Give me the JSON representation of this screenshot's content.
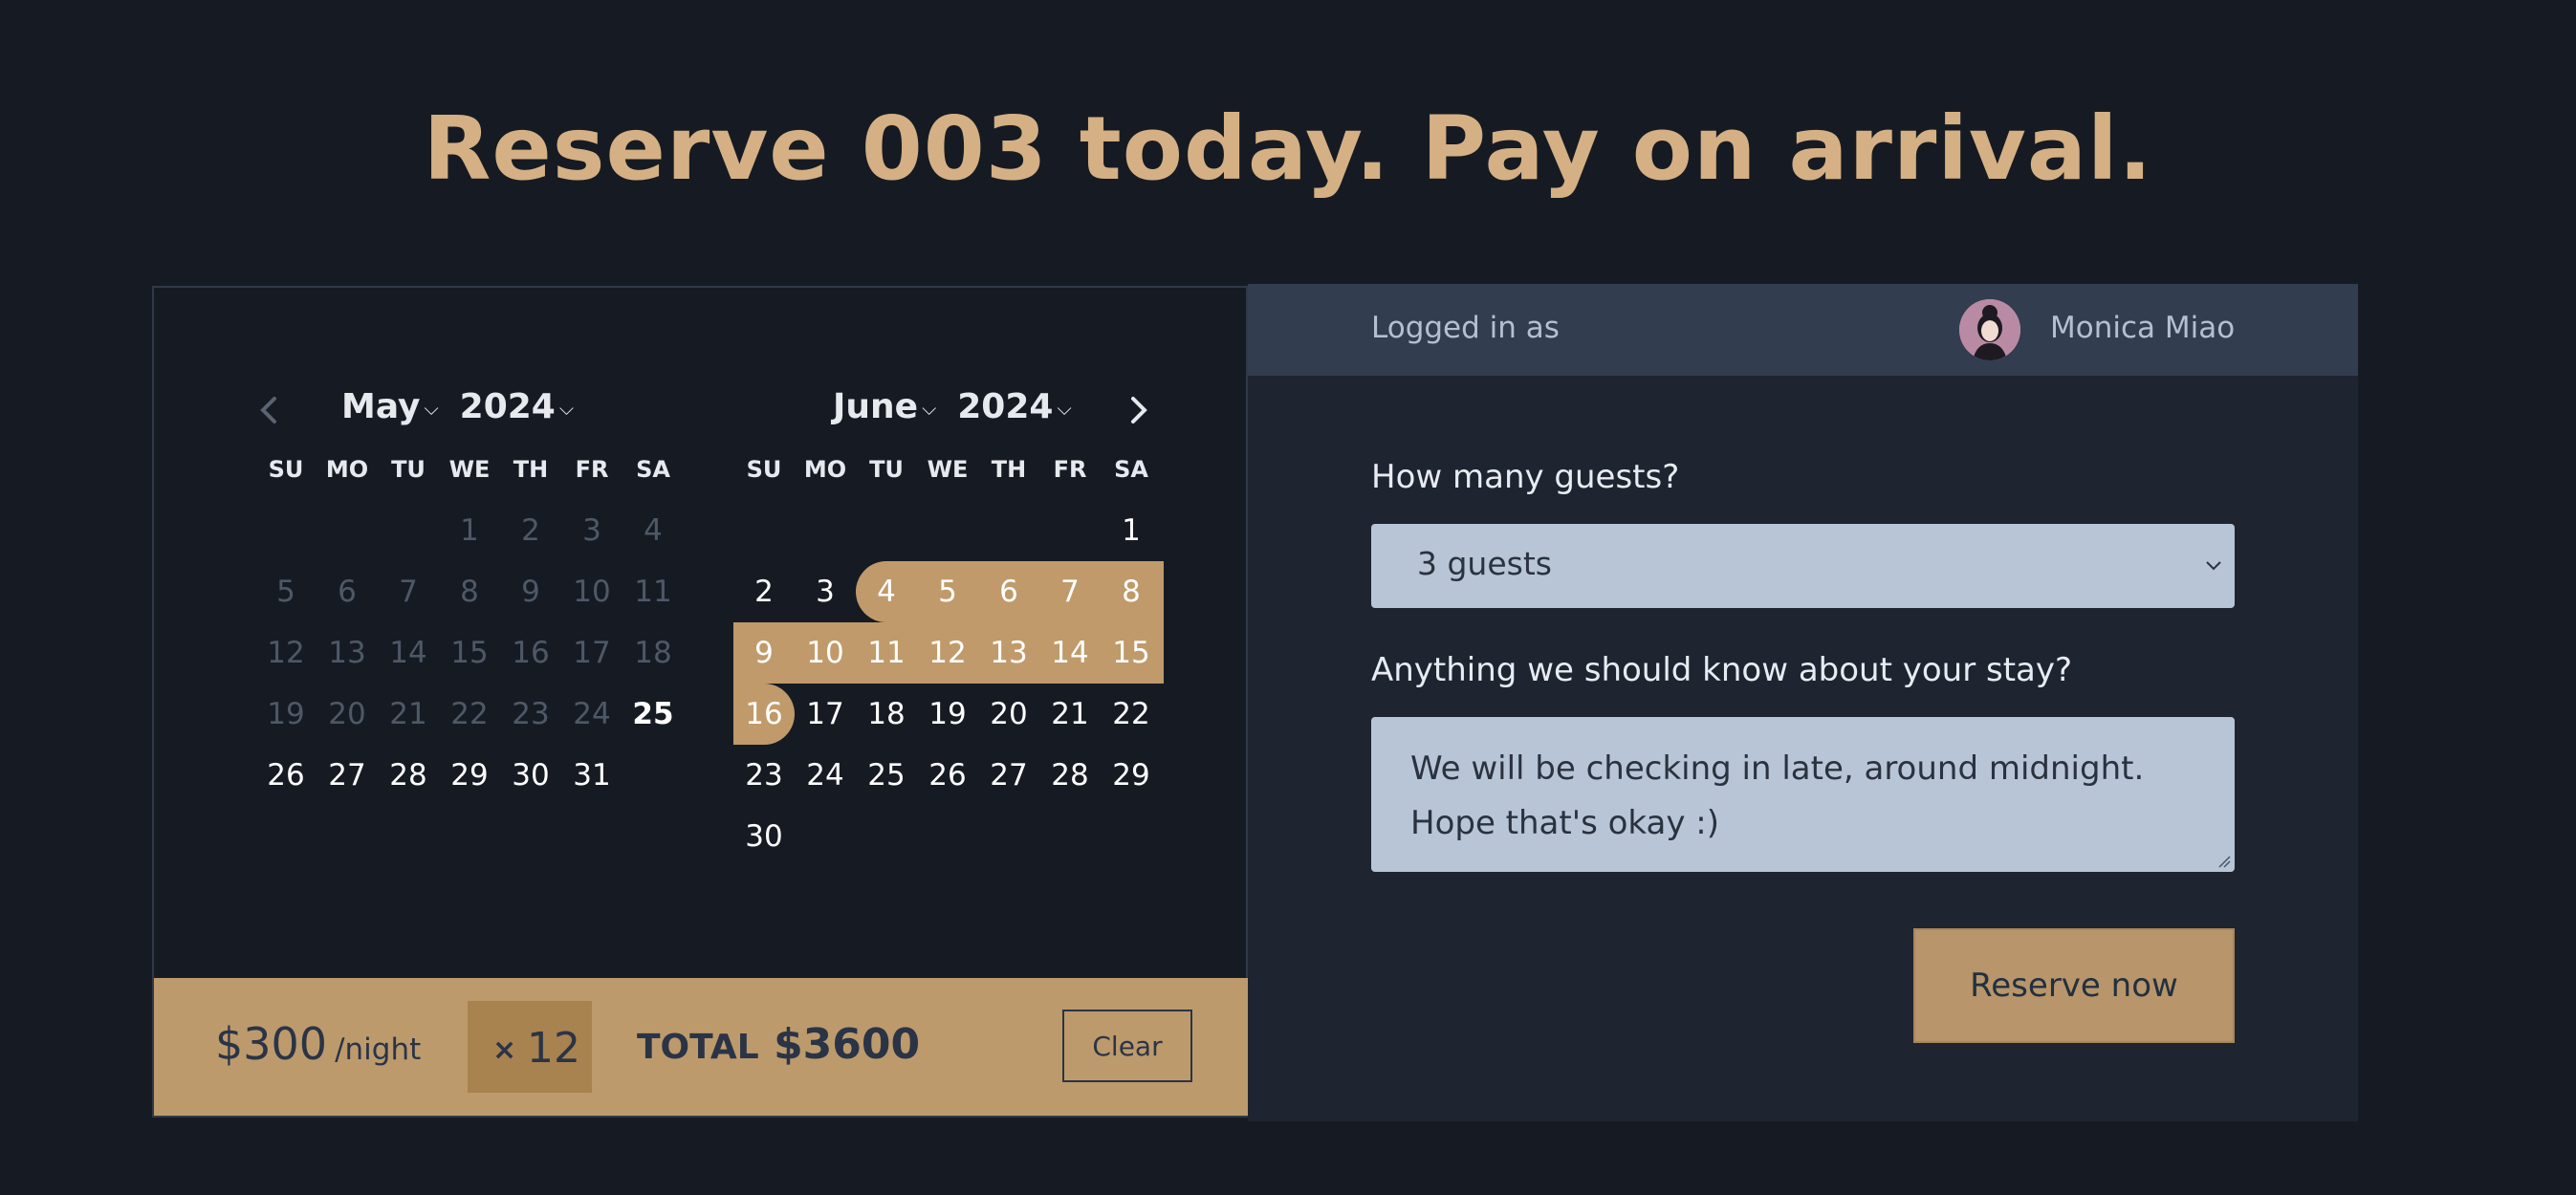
{
  "headline": "Reserve 003 today. Pay on arrival.",
  "login": {
    "label": "Logged in as",
    "user_name": "Monica Miao"
  },
  "form": {
    "guests_label": "How many guests?",
    "guests_value": "3 guests",
    "notes_label": "Anything we should know about your stay?",
    "notes_value": "We will be checking in late, around midnight.\nHope that's okay :)",
    "reserve_label": "Reserve now"
  },
  "calendar": {
    "weekdays": [
      "SU",
      "MO",
      "TU",
      "WE",
      "TH",
      "FR",
      "SA"
    ],
    "months": [
      {
        "month": "May",
        "year": "2024",
        "weeks": [
          [
            "",
            "",
            "",
            "1",
            "2",
            "3",
            "4"
          ],
          [
            "5",
            "6",
            "7",
            "8",
            "9",
            "10",
            "11"
          ],
          [
            "12",
            "13",
            "14",
            "15",
            "16",
            "17",
            "18"
          ],
          [
            "19",
            "20",
            "21",
            "22",
            "23",
            "24",
            "25"
          ],
          [
            "26",
            "27",
            "28",
            "29",
            "30",
            "31",
            ""
          ]
        ]
      },
      {
        "month": "June",
        "year": "2024",
        "weeks": [
          [
            "",
            "",
            "",
            "",
            "",
            "",
            "1"
          ],
          [
            "2",
            "3",
            "4",
            "5",
            "6",
            "7",
            "8"
          ],
          [
            "9",
            "10",
            "11",
            "12",
            "13",
            "14",
            "15"
          ],
          [
            "16",
            "17",
            "18",
            "19",
            "20",
            "21",
            "22"
          ],
          [
            "23",
            "24",
            "25",
            "26",
            "27",
            "28",
            "29"
          ],
          [
            "30",
            "",
            "",
            "",
            "",
            "",
            ""
          ]
        ]
      }
    ],
    "selected_range": {
      "start": "June 4",
      "end": "June 16"
    }
  },
  "pricing": {
    "price": "$300",
    "per_night": "/night",
    "times": "×",
    "nights": "12",
    "total_label": "TOTAL",
    "total_value": "$3600",
    "clear_label": "Clear"
  },
  "colors": {
    "accent": "#c09a6a",
    "background": "#161b23",
    "headline": "#d4b084"
  }
}
